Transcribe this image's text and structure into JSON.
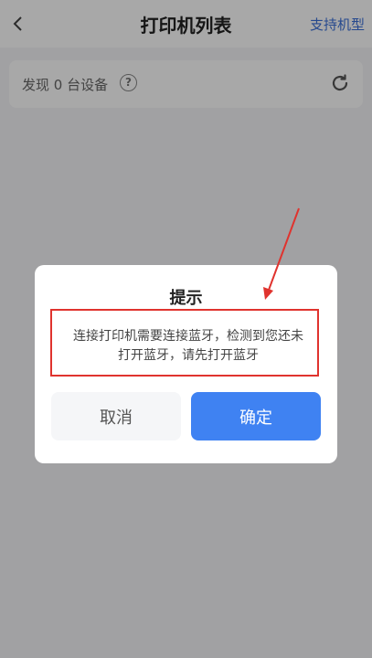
{
  "header": {
    "back_icon": "chevron-left-icon",
    "title": "打印机列表",
    "support_link": "支持机型"
  },
  "device_bar": {
    "count_text": "发现 0 台设备",
    "help_icon": "question-circle-icon",
    "help_glyph": "?",
    "refresh_icon": "refresh-icon"
  },
  "dialog": {
    "title": "提示",
    "message_line1": "连接打印机需要连接蓝牙，检测到您还未",
    "message_line2": "打开蓝牙，请先打开蓝牙",
    "cancel_label": "取消",
    "confirm_label": "确定"
  },
  "colors": {
    "accent_blue": "#3f82f2",
    "annotation_red": "#e0332e"
  }
}
